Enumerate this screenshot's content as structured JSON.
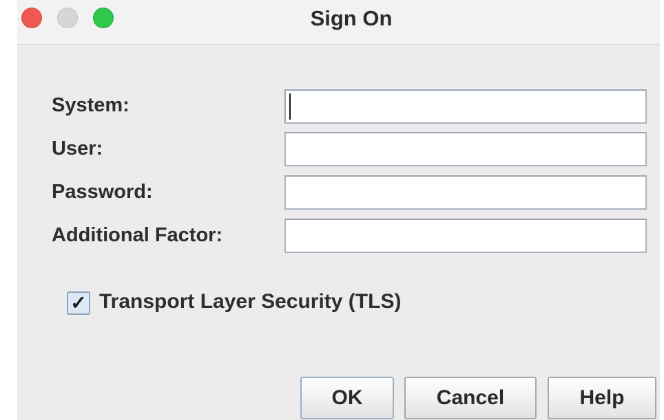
{
  "window": {
    "title": "Sign On"
  },
  "form": {
    "fields": [
      {
        "label": "System:",
        "value": "",
        "focused": true
      },
      {
        "label": "User:",
        "value": ""
      },
      {
        "label": "Password:",
        "value": ""
      },
      {
        "label": "Additional Factor:",
        "value": ""
      }
    ],
    "tls": {
      "label": "Transport Layer Security (TLS)",
      "checked": true,
      "mark": "✓"
    }
  },
  "buttons": {
    "ok": "OK",
    "cancel": "Cancel",
    "help": "Help"
  }
}
